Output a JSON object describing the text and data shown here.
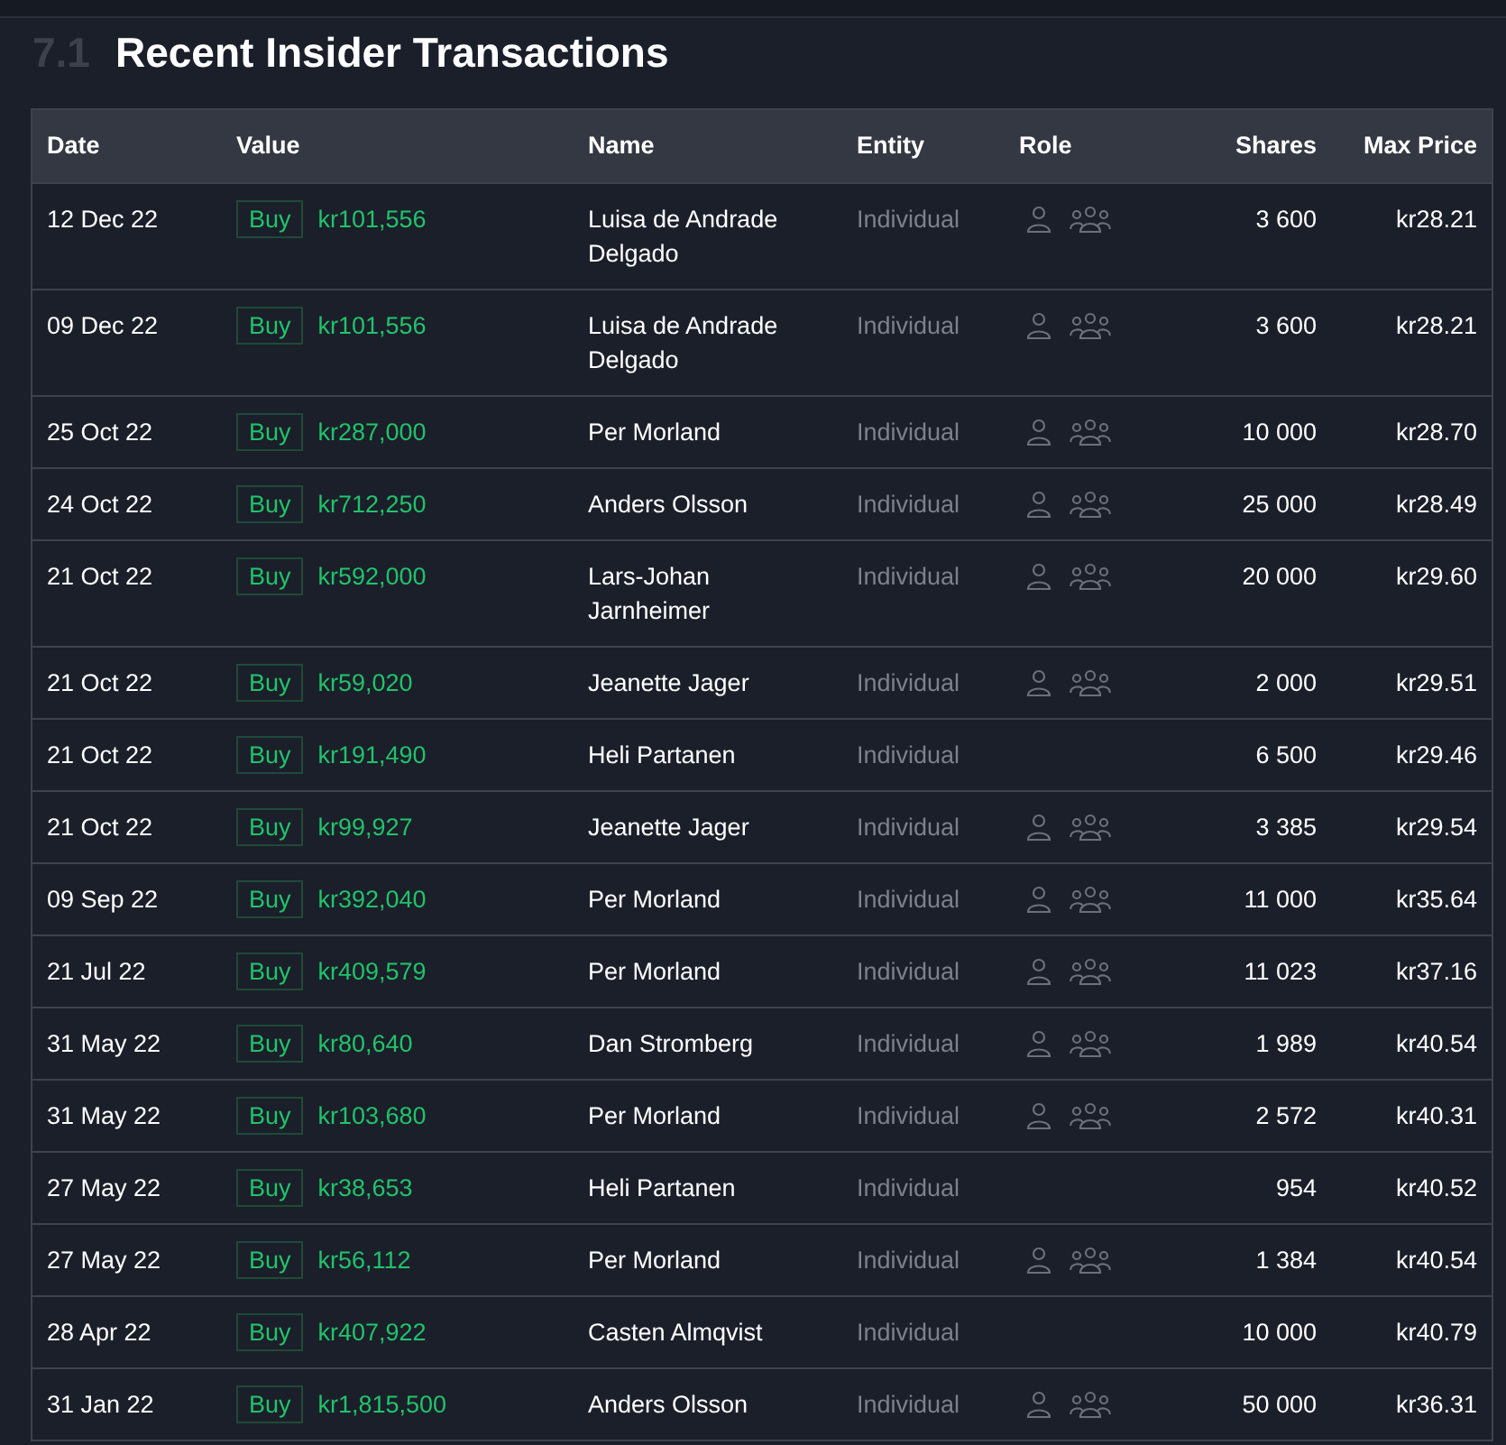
{
  "section": {
    "number": "7.1",
    "title": "Recent Insider Transactions"
  },
  "table": {
    "columns": [
      "Date",
      "Value",
      "Name",
      "Entity",
      "Role",
      "Shares",
      "Max Price"
    ],
    "rows": [
      {
        "date": "12 Dec 22",
        "type": "Buy",
        "value": "kr101,556",
        "name": "Luisa de Andrade Delgado",
        "entity": "Individual",
        "role_icons": true,
        "shares": "3 600",
        "max_price": "kr28.21"
      },
      {
        "date": "09 Dec 22",
        "type": "Buy",
        "value": "kr101,556",
        "name": "Luisa de Andrade Delgado",
        "entity": "Individual",
        "role_icons": true,
        "shares": "3 600",
        "max_price": "kr28.21"
      },
      {
        "date": "25 Oct 22",
        "type": "Buy",
        "value": "kr287,000",
        "name": "Per Morland",
        "entity": "Individual",
        "role_icons": true,
        "shares": "10 000",
        "max_price": "kr28.70"
      },
      {
        "date": "24 Oct 22",
        "type": "Buy",
        "value": "kr712,250",
        "name": "Anders Olsson",
        "entity": "Individual",
        "role_icons": true,
        "shares": "25 000",
        "max_price": "kr28.49"
      },
      {
        "date": "21 Oct 22",
        "type": "Buy",
        "value": "kr592,000",
        "name": "Lars-Johan Jarnheimer",
        "entity": "Individual",
        "role_icons": true,
        "shares": "20 000",
        "max_price": "kr29.60"
      },
      {
        "date": "21 Oct 22",
        "type": "Buy",
        "value": "kr59,020",
        "name": "Jeanette Jager",
        "entity": "Individual",
        "role_icons": true,
        "shares": "2 000",
        "max_price": "kr29.51"
      },
      {
        "date": "21 Oct 22",
        "type": "Buy",
        "value": "kr191,490",
        "name": "Heli Partanen",
        "entity": "Individual",
        "role_icons": false,
        "shares": "6 500",
        "max_price": "kr29.46"
      },
      {
        "date": "21 Oct 22",
        "type": "Buy",
        "value": "kr99,927",
        "name": "Jeanette Jager",
        "entity": "Individual",
        "role_icons": true,
        "shares": "3 385",
        "max_price": "kr29.54"
      },
      {
        "date": "09 Sep 22",
        "type": "Buy",
        "value": "kr392,040",
        "name": "Per Morland",
        "entity": "Individual",
        "role_icons": true,
        "shares": "11 000",
        "max_price": "kr35.64"
      },
      {
        "date": "21 Jul 22",
        "type": "Buy",
        "value": "kr409,579",
        "name": "Per Morland",
        "entity": "Individual",
        "role_icons": true,
        "shares": "11 023",
        "max_price": "kr37.16"
      },
      {
        "date": "31 May 22",
        "type": "Buy",
        "value": "kr80,640",
        "name": "Dan Stromberg",
        "entity": "Individual",
        "role_icons": true,
        "shares": "1 989",
        "max_price": "kr40.54"
      },
      {
        "date": "31 May 22",
        "type": "Buy",
        "value": "kr103,680",
        "name": "Per Morland",
        "entity": "Individual",
        "role_icons": true,
        "shares": "2 572",
        "max_price": "kr40.31"
      },
      {
        "date": "27 May 22",
        "type": "Buy",
        "value": "kr38,653",
        "name": "Heli Partanen",
        "entity": "Individual",
        "role_icons": false,
        "shares": "954",
        "max_price": "kr40.52"
      },
      {
        "date": "27 May 22",
        "type": "Buy",
        "value": "kr56,112",
        "name": "Per Morland",
        "entity": "Individual",
        "role_icons": true,
        "shares": "1 384",
        "max_price": "kr40.54"
      },
      {
        "date": "28 Apr 22",
        "type": "Buy",
        "value": "kr407,922",
        "name": "Casten Almqvist",
        "entity": "Individual",
        "role_icons": false,
        "shares": "10 000",
        "max_price": "kr40.79"
      },
      {
        "date": "31 Jan 22",
        "type": "Buy",
        "value": "kr1,815,500",
        "name": "Anders Olsson",
        "entity": "Individual",
        "role_icons": true,
        "shares": "50 000",
        "max_price": "kr36.31"
      }
    ]
  }
}
